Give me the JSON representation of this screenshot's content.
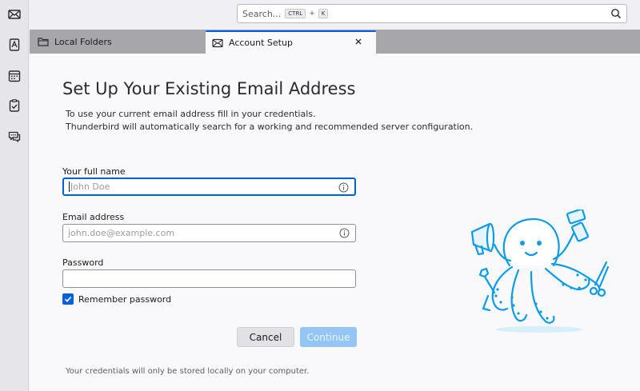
{
  "search": {
    "placeholder": "Search...",
    "key1": "CTRL",
    "plus": "+",
    "key2": "K"
  },
  "tabs": {
    "folders_label": "Local Folders",
    "setup_label": "Account Setup"
  },
  "setup": {
    "title": "Set Up Your Existing Email Address",
    "desc1": "To use your current email address fill in your credentials.",
    "desc2": "Thunderbird will automatically search for a working and recommended server configuration.",
    "name_label": "Your full name",
    "name_placeholder": "John Doe",
    "email_label": "Email address",
    "email_placeholder": "john.doe@example.com",
    "password_label": "Password",
    "remember_label": "Remember password",
    "remember_checked": true,
    "cancel_label": "Cancel",
    "continue_label": "Continue",
    "note": "Your credentials will only be stored locally on your computer."
  },
  "colors": {
    "accent": "#0061e0",
    "continue_disabled": "#93c6f5",
    "mascot": "#0b9bea"
  },
  "icons": [
    "mail-icon",
    "address-book-icon",
    "calendar-icon",
    "tasks-icon",
    "chat-icon",
    "search-icon",
    "folder-icon",
    "close-icon",
    "info-icon",
    "checkmark-icon"
  ]
}
